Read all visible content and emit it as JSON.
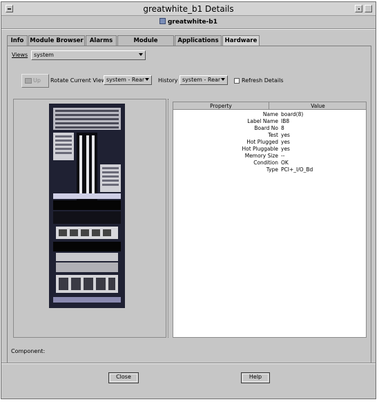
{
  "window": {
    "title": "greatwhite_b1 Details",
    "subtitle": "greatwhite-b1"
  },
  "tabs": [
    {
      "label": "Info"
    },
    {
      "label": "Module Browser"
    },
    {
      "label": "Alarms"
    },
    {
      "label": "Module Manager"
    },
    {
      "label": "Applications"
    },
    {
      "label": "Hardware",
      "active": true
    }
  ],
  "toolbar": {
    "views_label": "Views",
    "views_value": "system",
    "up_label": "Up",
    "rotate_label": "Rotate Current View",
    "rotate_value": "system - Rear",
    "history_label": "History",
    "history_value": "system - Rear",
    "refresh_label": "Refresh Details"
  },
  "table": {
    "headers": [
      "Property",
      "Value"
    ],
    "rows": [
      {
        "property": "Name",
        "value": "board(8)"
      },
      {
        "property": "Label Name",
        "value": "IB8"
      },
      {
        "property": "Board No",
        "value": "8"
      },
      {
        "property": "Test",
        "value": "yes"
      },
      {
        "property": "Hot Plugged",
        "value": "yes"
      },
      {
        "property": "Hot Pluggable",
        "value": "yes"
      },
      {
        "property": "Memory Size",
        "value": "--"
      },
      {
        "property": "Condition",
        "value": "OK"
      },
      {
        "property": "Type",
        "value": "PCI+_I/O_Bd"
      }
    ]
  },
  "status": {
    "component_label": "Component:"
  },
  "footer": {
    "close_label": "Close",
    "help_label": "Help"
  },
  "icons": {
    "app": "server-icon",
    "up": "folder-up-icon"
  }
}
